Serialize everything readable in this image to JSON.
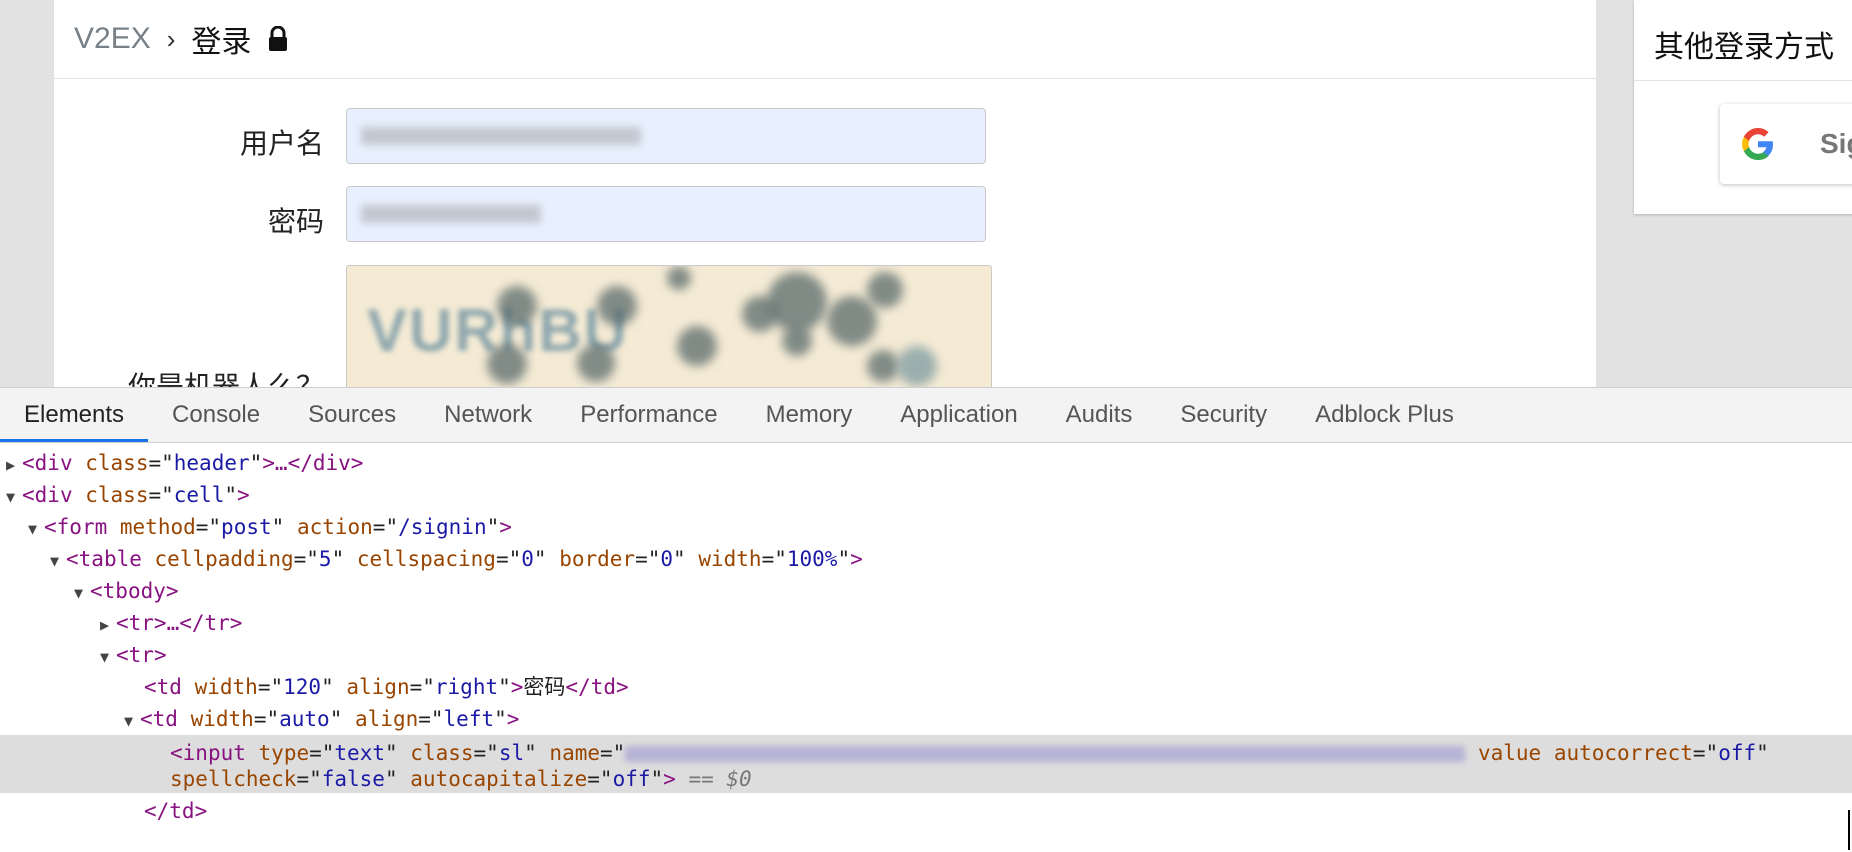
{
  "page": {
    "breadcrumb": {
      "home": "V2EX",
      "separator": "›",
      "current": "登录"
    },
    "form": {
      "username_label": "用户名",
      "password_label": "密码",
      "robot_label": "你是机器人么？",
      "captcha_text": "VURhBU"
    },
    "sidebar": {
      "title": "其他登录方式",
      "google_button": "Sig"
    }
  },
  "devtools": {
    "tabs": [
      "Elements",
      "Console",
      "Sources",
      "Network",
      "Performance",
      "Memory",
      "Application",
      "Audits",
      "Security",
      "Adblock Plus"
    ],
    "active_tab": "Elements",
    "tree": {
      "l1": {
        "tag": "div",
        "attr": "class",
        "val": "header",
        "tail": ">…</div>"
      },
      "l2": {
        "tag": "div",
        "attr": "class",
        "val": "cell"
      },
      "l3": {
        "tag": "form",
        "a1": "method",
        "v1": "post",
        "a2": "action",
        "v2": "/signin"
      },
      "l4": {
        "tag": "table",
        "a1": "cellpadding",
        "v1": "5",
        "a2": "cellspacing",
        "v2": "0",
        "a3": "border",
        "v3": "0",
        "a4": "width",
        "v4": "100%"
      },
      "l5": {
        "tag": "tbody"
      },
      "l6": {
        "text": "<tr>…</tr>"
      },
      "l7": {
        "tag": "tr"
      },
      "l8": {
        "tag": "td",
        "a1": "width",
        "v1": "120",
        "a2": "align",
        "v2": "right",
        "content": "密码",
        "close": "</td>"
      },
      "l9": {
        "tag": "td",
        "a1": "width",
        "v1": "auto",
        "a2": "align",
        "v2": "left"
      },
      "l10": {
        "tag": "input",
        "a1": "type",
        "v1": "text",
        "a2": "class",
        "v2": "sl",
        "a3": "name",
        "a4": "value",
        "a5": "autocorrect",
        "v5": "off"
      },
      "l11": {
        "a1": "spellcheck",
        "v1": "false",
        "a2": "autocapitalize",
        "v2": "off",
        "marker": "== $0"
      },
      "l12": {
        "text": "</td>"
      }
    }
  }
}
